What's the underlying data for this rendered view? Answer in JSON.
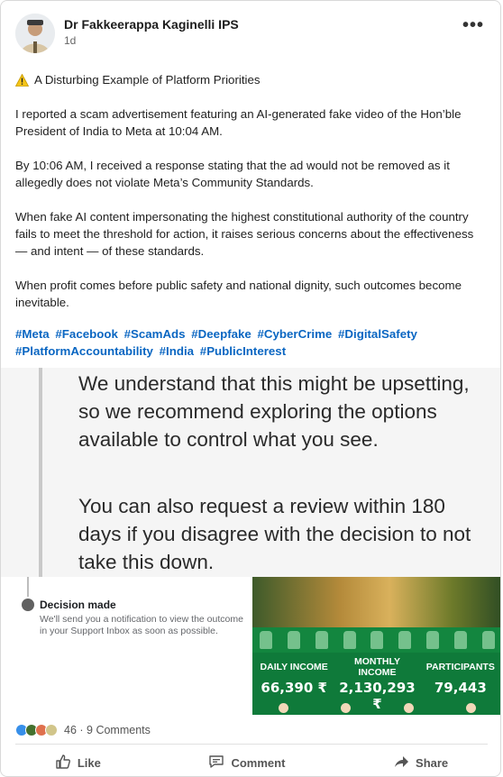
{
  "post": {
    "author": "Dr Fakkeerappa Kaginelli IPS",
    "time": "1d",
    "headline": "A Disturbing Example of Platform Priorities",
    "paragraphs": [
      "I reported a scam advertisement featuring an AI-generated fake video of the Hon’ble President of India to Meta at 10:04 AM.",
      "By 10:06 AM, I received a response stating that the ad would not be removed as it allegedly does not violate Meta’s Community Standards.",
      "When fake AI content impersonating the highest constitutional authority of the country fails to meet the threshold for action, it raises serious concerns about the effectiveness — and intent — of these standards.",
      "When profit comes before public safety and national dignity, such outcomes become inevitable."
    ],
    "hashtags": [
      "#Meta",
      "#Facebook",
      "#ScamAds",
      "#Deepfake",
      "#CyberCrime",
      "#DigitalSafety",
      "#PlatformAccountability",
      "#India",
      "#PublicInterest"
    ]
  },
  "media": {
    "quote1": "We understand that this might be upsetting, so we recommend exploring the options available to control what you see.",
    "quote2": "You can also request a review within 180 days if you disagree with the decision to not take this down.",
    "decision_title": "Decision made",
    "decision_text": "We'll send you a notification to view the outcome in your Support Inbox as soon as possible.",
    "stats_headers": [
      "DAILY INCOME",
      "MONTHLY INCOME",
      "PARTICIPANTS"
    ],
    "stats_values": [
      "66,390 ₹",
      "2,130,293 ₹",
      "79,443"
    ]
  },
  "social": {
    "reaction_count": "46",
    "comments": "9 Comments",
    "like": "Like",
    "comment": "Comment",
    "share": "Share"
  }
}
